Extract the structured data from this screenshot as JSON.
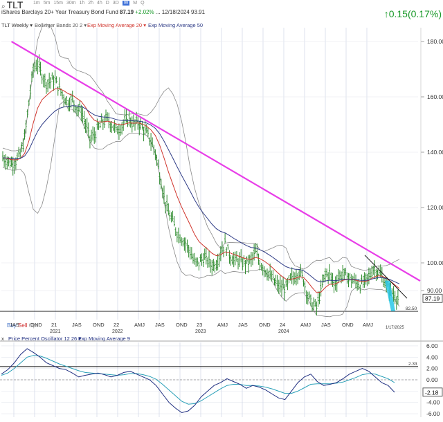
{
  "header": {
    "symbol": "TLT",
    "intervals": [
      "1m",
      "5m",
      "15m",
      "30m",
      "1h",
      "2h",
      "4h",
      "D",
      "3D",
      "W",
      "M",
      "Q"
    ],
    "selected_interval": "W",
    "fund_name": "iShares Barclays 20+ Year Treasury Bond Fund",
    "price": "87.19",
    "pct_change": "+2.02%",
    "ellipsis": "...",
    "date": "12/18/2024",
    "extra_value": "93.91",
    "change_display": "0.15(0.17%)"
  },
  "indicators": {
    "symbol_tag": "TLT Weekly",
    "bollinger": "Bollinger Bands 20 2",
    "ema20": "Exp Moving Average 20",
    "ema50": "Exp Moving Average 50",
    "ppo": "Price Percent Oscillator 12 26",
    "ppo_ema": "Exp Moving Average 9"
  },
  "buttons": {
    "buy": "Buy",
    "sell": "Sell",
    "opt": "Opt",
    "close_x": "x"
  },
  "colors": {
    "candle": "#2c8a2c",
    "ema20": "#d0342c",
    "ema50": "#2e3b86",
    "bands": "#888888",
    "trendline": "#e83ee8",
    "highlight": "#28c8e8",
    "ppo": "#1f2e80",
    "ppo_signal": "#2aa0b8",
    "up": "#1a9a2a"
  },
  "chart_data": [
    {
      "type": "candlestick",
      "title": "TLT Weekly",
      "x_tick_labels": [
        "JAS",
        "OND",
        "21",
        "JAS",
        "OND",
        "22",
        "AMJ",
        "JAS",
        "OND",
        "23",
        "AMJ",
        "JAS",
        "OND",
        "24",
        "AMJ",
        "JAS",
        "OND",
        "AMJ"
      ],
      "year_labels": [
        "2021",
        "2022",
        "2023",
        "2024"
      ],
      "future_date_label": "1/17/2025",
      "y_ticks": [
        90,
        100,
        120,
        140,
        160,
        180
      ],
      "y_tick_labels": [
        "90.00",
        "100.00",
        "120.00",
        "140.00",
        "160.00",
        "180.00"
      ],
      "ylim": [
        80,
        185
      ],
      "last_price_label": "87.19",
      "support_level_label": "82.50",
      "support_level": 82.5,
      "series": [
        {
          "name": "TLT Weekly",
          "style": "ohlc",
          "values": [
            138,
            137,
            136,
            137,
            139,
            145,
            158,
            170,
            172,
            168,
            165,
            166,
            166,
            163,
            160,
            158,
            159,
            156,
            155,
            150,
            145,
            146,
            149,
            151,
            152,
            150,
            148,
            149,
            151,
            152,
            150,
            151,
            149,
            147,
            144,
            140,
            132,
            124,
            118,
            115,
            111,
            109,
            107,
            104,
            100,
            100,
            102,
            101,
            99,
            100,
            104,
            107,
            103,
            101,
            101,
            100,
            100,
            101,
            104,
            100,
            98,
            96,
            94,
            92,
            91,
            91,
            94,
            95,
            97,
            94,
            88,
            85,
            84,
            90,
            96,
            96,
            92,
            95,
            96,
            95,
            94,
            93,
            92,
            93,
            95,
            98,
            97,
            95,
            92,
            90,
            88,
            87
          ]
        }
      ],
      "overlays": [
        "Bollinger Bands 20 2",
        "Exp Moving Average 20",
        "Exp Moving Average 50"
      ],
      "annotations": [
        "long-term downtrend line",
        "short-term downtrend line",
        "projected decline highlight"
      ]
    },
    {
      "type": "line",
      "title": "Price Percent Oscillator 12 26",
      "series": [
        {
          "name": "Price Percent Oscillator 12 26",
          "values": [
            1.0,
            1.8,
            3.0,
            4.5,
            5.5,
            4.8,
            4.0,
            3.0,
            2.5,
            2.0,
            1.8,
            1.2,
            0.5,
            0.8,
            1.0,
            1.2,
            0.9,
            0.5,
            0.8,
            1.3,
            1.5,
            1.0,
            0.5,
            0.0,
            -1.0,
            -2.5,
            -4.0,
            -5.0,
            -5.8,
            -5.5,
            -4.5,
            -3.0,
            -2.0,
            -1.0,
            -0.5,
            0.2,
            -0.3,
            -0.8,
            -1.5,
            -1.0,
            -1.3,
            -1.8,
            -2.5,
            -3.2,
            -3.5,
            -2.0,
            -0.5,
            0.5,
            1.0,
            -0.3,
            -1.0,
            -0.8,
            -0.5,
            0.2,
            1.0,
            1.5,
            2.0,
            1.5,
            0.5,
            -0.5,
            -1.0,
            -2.2
          ]
        },
        {
          "name": "Exp Moving Average 9",
          "values": [
            0.8,
            1.2,
            2.0,
            3.0,
            4.0,
            4.3,
            4.2,
            3.8,
            3.3,
            2.8,
            2.4,
            2.0,
            1.6,
            1.3,
            1.2,
            1.1,
            1.0,
            0.9,
            0.8,
            0.9,
            1.1,
            1.1,
            0.9,
            0.6,
            0.1,
            -0.8,
            -1.8,
            -2.8,
            -3.8,
            -4.3,
            -4.2,
            -3.7,
            -3.0,
            -2.3,
            -1.6,
            -1.0,
            -0.8,
            -0.8,
            -1.0,
            -1.0,
            -1.1,
            -1.3,
            -1.6,
            -2.0,
            -2.4,
            -2.4,
            -2.0,
            -1.4,
            -0.8,
            -0.7,
            -0.7,
            -0.7,
            -0.6,
            -0.4,
            0.0,
            0.4,
            0.9,
            1.1,
            1.0,
            0.6,
            0.2,
            -0.5
          ]
        }
      ],
      "y_ticks": [
        -6,
        -4,
        -2,
        0,
        2,
        4,
        6
      ],
      "y_tick_labels": [
        "-6.00",
        "-4.00",
        "-2.00",
        "0.00",
        "2.00",
        "4.00",
        "6.00"
      ],
      "ylim": [
        -6.6,
        6.6
      ],
      "reference_level_label": "2.33",
      "reference_level": 2.33,
      "last_value_label": "-2.18"
    }
  ]
}
